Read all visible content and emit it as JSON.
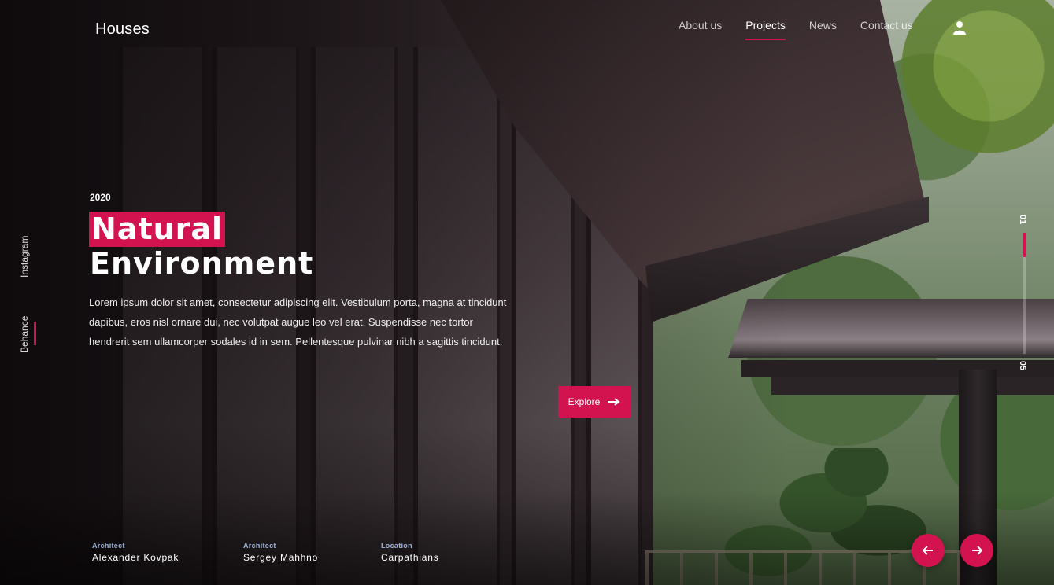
{
  "brand": {
    "logo": "Houses"
  },
  "nav": {
    "items": [
      {
        "label": "About us"
      },
      {
        "label": "Projects",
        "active": true
      },
      {
        "label": "News"
      },
      {
        "label": "Contact us"
      }
    ],
    "user_icon": "user-icon"
  },
  "social": {
    "instagram": "Instagram",
    "behance": "Behance"
  },
  "hero": {
    "year": "2020",
    "title_highlight": "Natural",
    "title_rest": "Environment",
    "description": "Lorem ipsum dolor sit amet, consectetur adipiscing elit. Vestibulum porta, magna at tincidunt dapibus, eros nisl ornare dui, nec volutpat augue leo vel erat. Suspendisse nec tortor hendrerit sem ullamcorper sodales id in sem. Pellentesque pulvinar nibh a sagittis tincidunt.",
    "cta_label": "Explore",
    "cta_icon": "arrow-right-icon"
  },
  "pager": {
    "current": "01",
    "total": "05",
    "progress": 0.2
  },
  "credits": [
    {
      "label": "Architect",
      "value": "Alexander Kovpak"
    },
    {
      "label": "Architect",
      "value": "Sergey Mahhno"
    },
    {
      "label": "Location",
      "value": "Carpathians"
    }
  ],
  "colors": {
    "accent": "#d3134f",
    "credit_label": "#9fb4d8"
  },
  "controls": {
    "prev_icon": "arrow-left-icon",
    "next_icon": "arrow-right-icon"
  }
}
